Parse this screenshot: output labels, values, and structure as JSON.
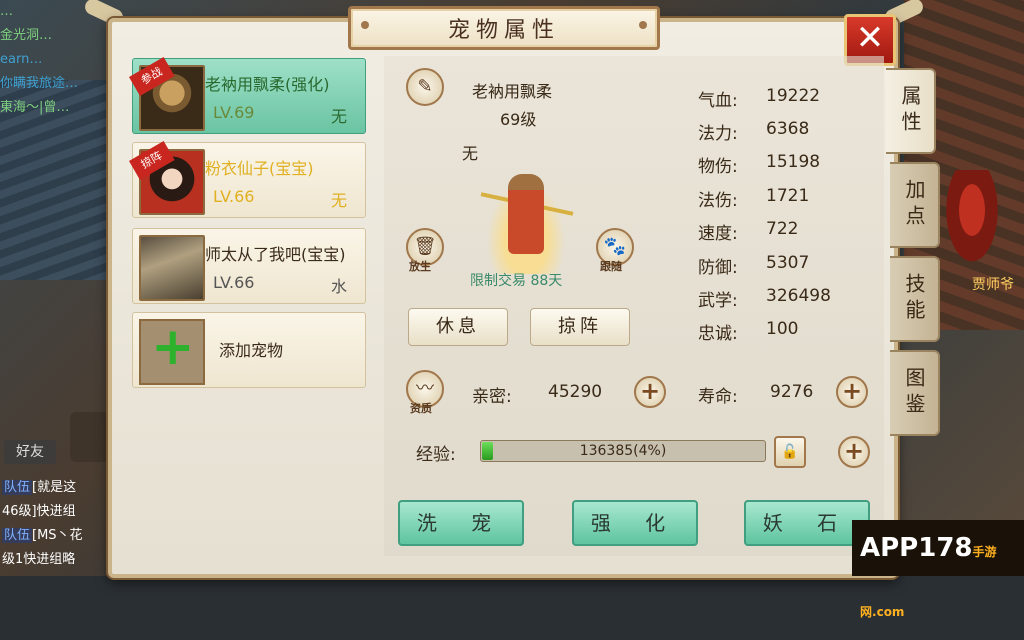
{
  "background": {
    "chat_top": [
      "…",
      "金光洞…",
      "earn…",
      "你瞒我旅途…",
      "東海〜|曾…"
    ],
    "chat_bottom": [
      {
        "tag": "队伍",
        "text": "[就是这"
      },
      {
        "tag": "",
        "text": "46级]快进组"
      },
      {
        "tag": "队伍",
        "text": "[MS丶花"
      },
      {
        "tag": "",
        "text": "级1快进组略"
      }
    ],
    "friend_button": "好友",
    "npc_name": "贾师爷"
  },
  "window": {
    "title": "宠物属性",
    "close": "✕"
  },
  "pets": [
    {
      "name": "老衲用飘柔(强化)",
      "level": "LV.69",
      "element": "无",
      "badge": "参战"
    },
    {
      "name": "粉衣仙子(宝宝)",
      "level": "LV.66",
      "element": "无",
      "badge": "掠阵"
    },
    {
      "name": "师太从了我吧(宝宝)",
      "level": "LV.66",
      "element": "水",
      "badge": ""
    }
  ],
  "add_pet": "添加宠物",
  "detail": {
    "name": "老衲用飘柔",
    "level": "69级",
    "element": "无",
    "trade": "限制交易 88天",
    "release_label": "放生",
    "follow_label": "跟随",
    "aptitude_label": "资质",
    "rest_button": "休息",
    "formation_button": "掠阵"
  },
  "stats": [
    {
      "label": "气血:",
      "value": "19222"
    },
    {
      "label": "法力:",
      "value": "6368"
    },
    {
      "label": "物伤:",
      "value": "15198"
    },
    {
      "label": "法伤:",
      "value": "1721"
    },
    {
      "label": "速度:",
      "value": "722"
    },
    {
      "label": "防御:",
      "value": "5307"
    },
    {
      "label": "武学:",
      "value": "326498"
    },
    {
      "label": "忠诚:",
      "value": "100"
    }
  ],
  "intimacy": {
    "label": "亲密:",
    "value": "45290"
  },
  "lifespan": {
    "label": "寿命:",
    "value": "9276"
  },
  "experience": {
    "label": "经验:",
    "value": "136385(4%)",
    "progress": 0.04
  },
  "actions": [
    "洗 宠",
    "强 化",
    "妖 石"
  ],
  "tabs": [
    "属性",
    "加点",
    "技能",
    "图鉴"
  ],
  "watermark": {
    "main": "APP178",
    "sub": "手游网",
    "domain": ".com"
  }
}
